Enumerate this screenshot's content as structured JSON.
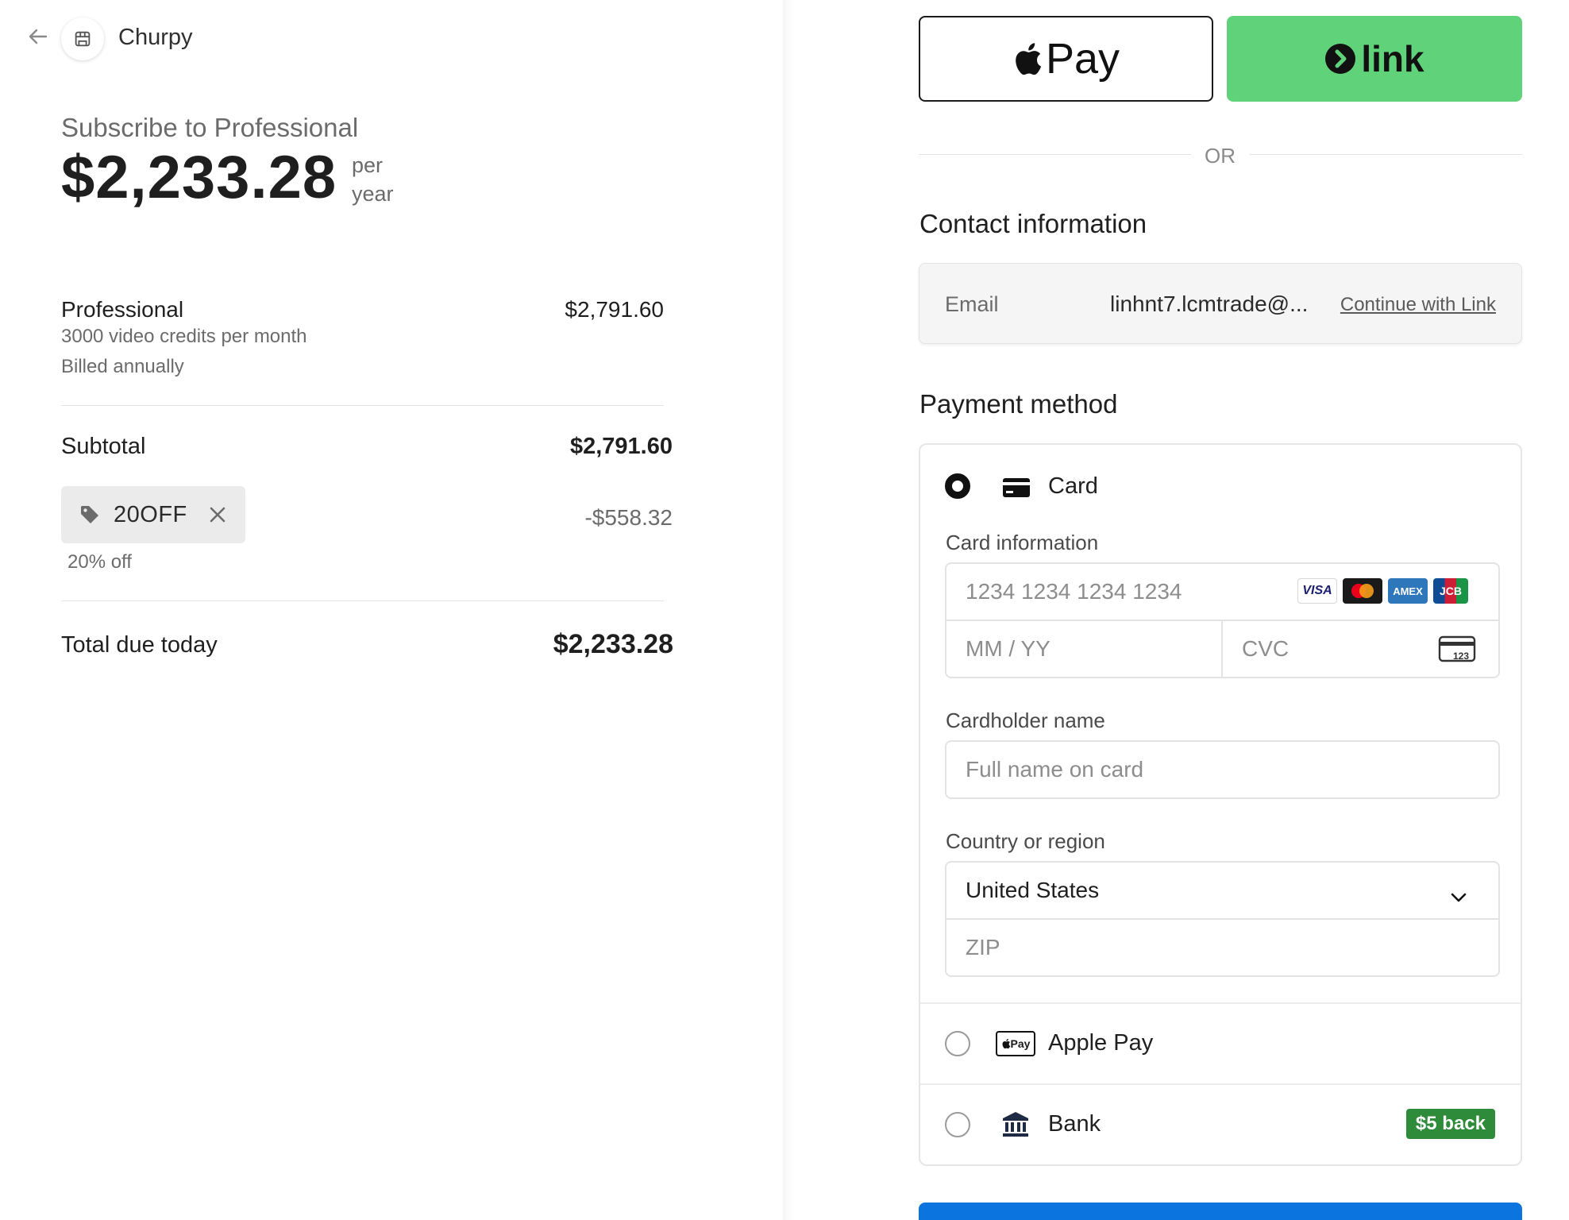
{
  "header": {
    "brand_name": "Churpy"
  },
  "summary": {
    "title": "Subscribe to Professional",
    "price": "$2,233.28",
    "price_period_line1": "per",
    "price_period_line2": "year",
    "item": {
      "name": "Professional",
      "description": "3000 video credits per month",
      "billing": "Billed annually",
      "price": "$2,791.60"
    },
    "subtotal_label": "Subtotal",
    "subtotal_value": "$2,791.60",
    "promo": {
      "code": "20OFF",
      "note": "20% off",
      "amount": "-$558.32"
    },
    "total_label": "Total due today",
    "total_value": "$2,233.28"
  },
  "express": {
    "apple_pay_label": "Pay",
    "link_label": "link",
    "or_text": "OR"
  },
  "contact": {
    "title": "Contact information",
    "email_label": "Email",
    "email_value": "linhnt7.lcmtrade@...",
    "continue_link": "Continue with Link"
  },
  "payment": {
    "title": "Payment method",
    "card_label": "Card",
    "card_info_label": "Card information",
    "card_number_placeholder": "1234 1234 1234 1234",
    "expiry_placeholder": "MM / YY",
    "cvc_placeholder": "CVC",
    "cvc_icon_text": "123",
    "card_brands": [
      "VISA",
      "MC",
      "AMEX",
      "JCB"
    ],
    "cardholder_label": "Cardholder name",
    "cardholder_placeholder": "Full name on card",
    "country_label": "Country or region",
    "country_value": "United States",
    "zip_placeholder": "ZIP",
    "apple_pay_option": "Apple Pay",
    "apple_pay_icon_text": "Pay",
    "bank_option": "Bank",
    "bank_badge": "$5 back"
  },
  "colors": {
    "link_green": "#5fd27a",
    "bank_badge_green": "#2e8b3a",
    "pay_button_blue": "#0b74de"
  }
}
